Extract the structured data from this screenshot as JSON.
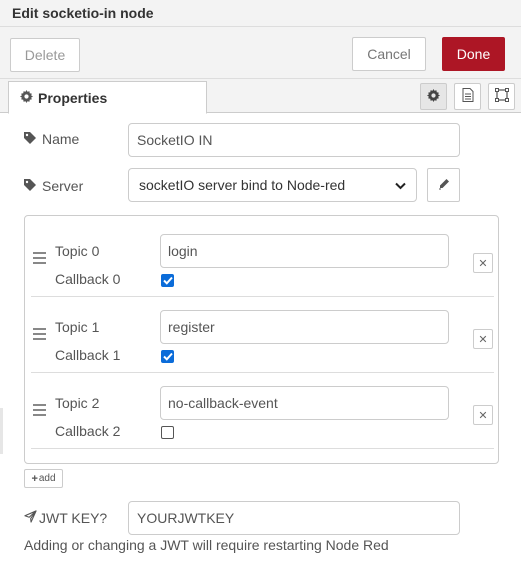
{
  "dialog": {
    "title": "Edit socketio-in node"
  },
  "toolbar": {
    "delete_label": "Delete",
    "cancel_label": "Cancel",
    "done_label": "Done"
  },
  "tabs": {
    "properties_label": "Properties",
    "icons": [
      "gear-icon",
      "description-icon",
      "appearance-icon"
    ]
  },
  "form": {
    "name_label": "Name",
    "name_value": "SocketIO IN",
    "server_label": "Server",
    "server_value": "socketIO server bind to Node-red",
    "jwt_label": "JWT KEY?",
    "jwt_value": "YOURJWTKEY",
    "help_text": "Adding or changing a JWT will require restarting Node Red",
    "add_label": "add"
  },
  "topics": [
    {
      "topic_label": "Topic 0",
      "topic_value": "login",
      "callback_label": "Callback 0",
      "callback_checked": true
    },
    {
      "topic_label": "Topic 1",
      "topic_value": "register",
      "callback_label": "Callback 1",
      "callback_checked": true
    },
    {
      "topic_label": "Topic 2",
      "topic_value": "no-callback-event",
      "callback_label": "Callback 2",
      "callback_checked": false
    }
  ],
  "colors": {
    "done_button": "#ad1625",
    "checkbox_checked": "#0b6cd9",
    "header_bg": "#f3f3f3"
  }
}
